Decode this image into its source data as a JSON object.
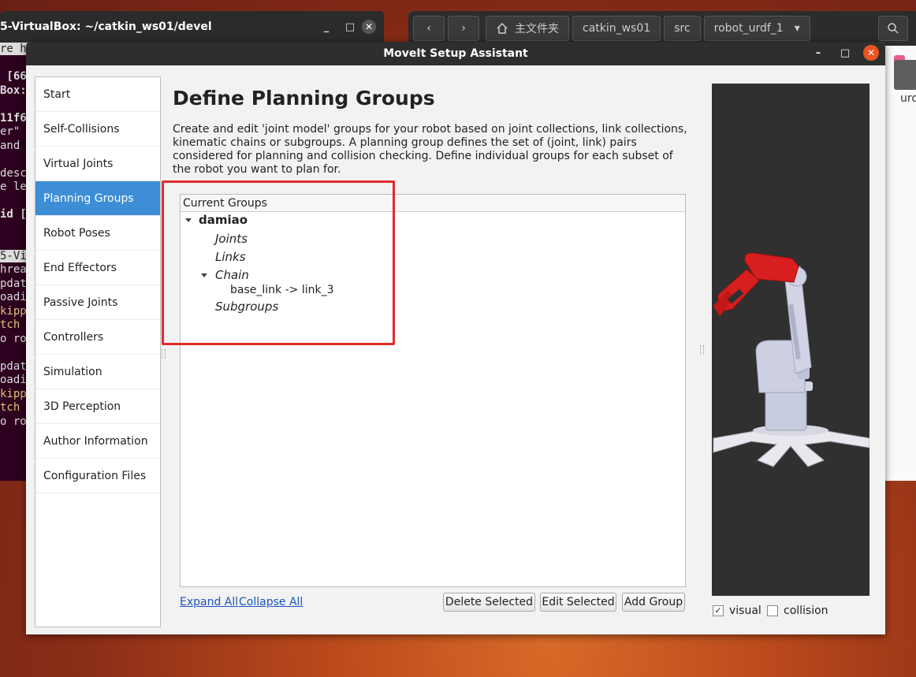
{
  "terminal": {
    "title": "5-VirtualBox: ~/catkin_ws01/devel",
    "minimize": "_",
    "maximize": "□",
    "close": "✕",
    "lines": [
      {
        "text": "re ht",
        "style": "hl"
      },
      {
        "text": "",
        "style": ""
      },
      {
        "text": " [66",
        "style": "b"
      },
      {
        "text": "Box:",
        "style": "b"
      },
      {
        "text": "",
        "style": ""
      },
      {
        "text": "11f6",
        "style": "b"
      },
      {
        "text": "er\"",
        "style": ""
      },
      {
        "text": "and",
        "style": ""
      },
      {
        "text": "",
        "style": ""
      },
      {
        "text": "desc",
        "style": ""
      },
      {
        "text": "e le",
        "style": ""
      },
      {
        "text": "",
        "style": ""
      },
      {
        "text": "id [",
        "style": "b"
      },
      {
        "text": "",
        "style": ""
      },
      {
        "text": "",
        "style": ""
      },
      {
        "text": "5-Virt",
        "style": "hl"
      },
      {
        "text": "hrea",
        "style": ""
      },
      {
        "text": "pdat",
        "style": ""
      },
      {
        "text": "oadi",
        "style": ""
      },
      {
        "text": "kipp",
        "style": "y"
      },
      {
        "text": "tch",
        "style": "y"
      },
      {
        "text": "o ro",
        "style": ""
      },
      {
        "text": "",
        "style": ""
      },
      {
        "text": "pdat",
        "style": ""
      },
      {
        "text": "oadi",
        "style": ""
      },
      {
        "text": "kipp",
        "style": "y"
      },
      {
        "text": "tch",
        "style": "y"
      },
      {
        "text": "o ro",
        "style": ""
      }
    ]
  },
  "files": {
    "back_icon": "‹",
    "forward_icon": "›",
    "home_label": "主文件夹",
    "crumbs": [
      "catkin_ws01",
      "src",
      "robot_urdf_1"
    ],
    "dropdown_icon": "▾",
    "folder_name": "urd"
  },
  "dialog": {
    "title": "MoveIt Setup Assistant",
    "minimize": "–",
    "maximize": "□",
    "close": "✕"
  },
  "sidebar": {
    "active_index": 3,
    "items": [
      {
        "label": "Start"
      },
      {
        "label": "Self-Collisions"
      },
      {
        "label": "Virtual Joints"
      },
      {
        "label": "Planning Groups"
      },
      {
        "label": "Robot Poses"
      },
      {
        "label": "End Effectors"
      },
      {
        "label": "Passive Joints"
      },
      {
        "label": "Controllers"
      },
      {
        "label": "Simulation"
      },
      {
        "label": "3D Perception"
      },
      {
        "label": "Author Information"
      },
      {
        "label": "Configuration Files"
      }
    ]
  },
  "main": {
    "title": "Define Planning Groups",
    "description": "Create and edit 'joint model' groups for your robot based on joint collections, link collections, kinematic chains or subgroups. A planning group defines the set of (joint, link) pairs considered for planning and collision checking. Define individual groups for each subset of the robot you want to plan for."
  },
  "groups": {
    "header": "Current Groups",
    "group_name": "damiao",
    "joints": "Joints",
    "links": "Links",
    "chain": "Chain",
    "chain_entry": "base_link  ->  link_3",
    "subgroups": "Subgroups"
  },
  "actions": {
    "expand_all": "Expand All",
    "collapse_all": "Collapse All",
    "delete_selected": "Delete Selected",
    "edit_selected": "Edit Selected",
    "add_group": "Add Group"
  },
  "viewer": {
    "visual_label": "visual",
    "visual_checked": true,
    "collision_label": "collision",
    "collision_checked": false,
    "check_mark": "✓",
    "colors": {
      "background": "#303030",
      "gripper": "#d81e1e",
      "links": "#c9ccdc",
      "base": "#e8e8ee"
    }
  }
}
